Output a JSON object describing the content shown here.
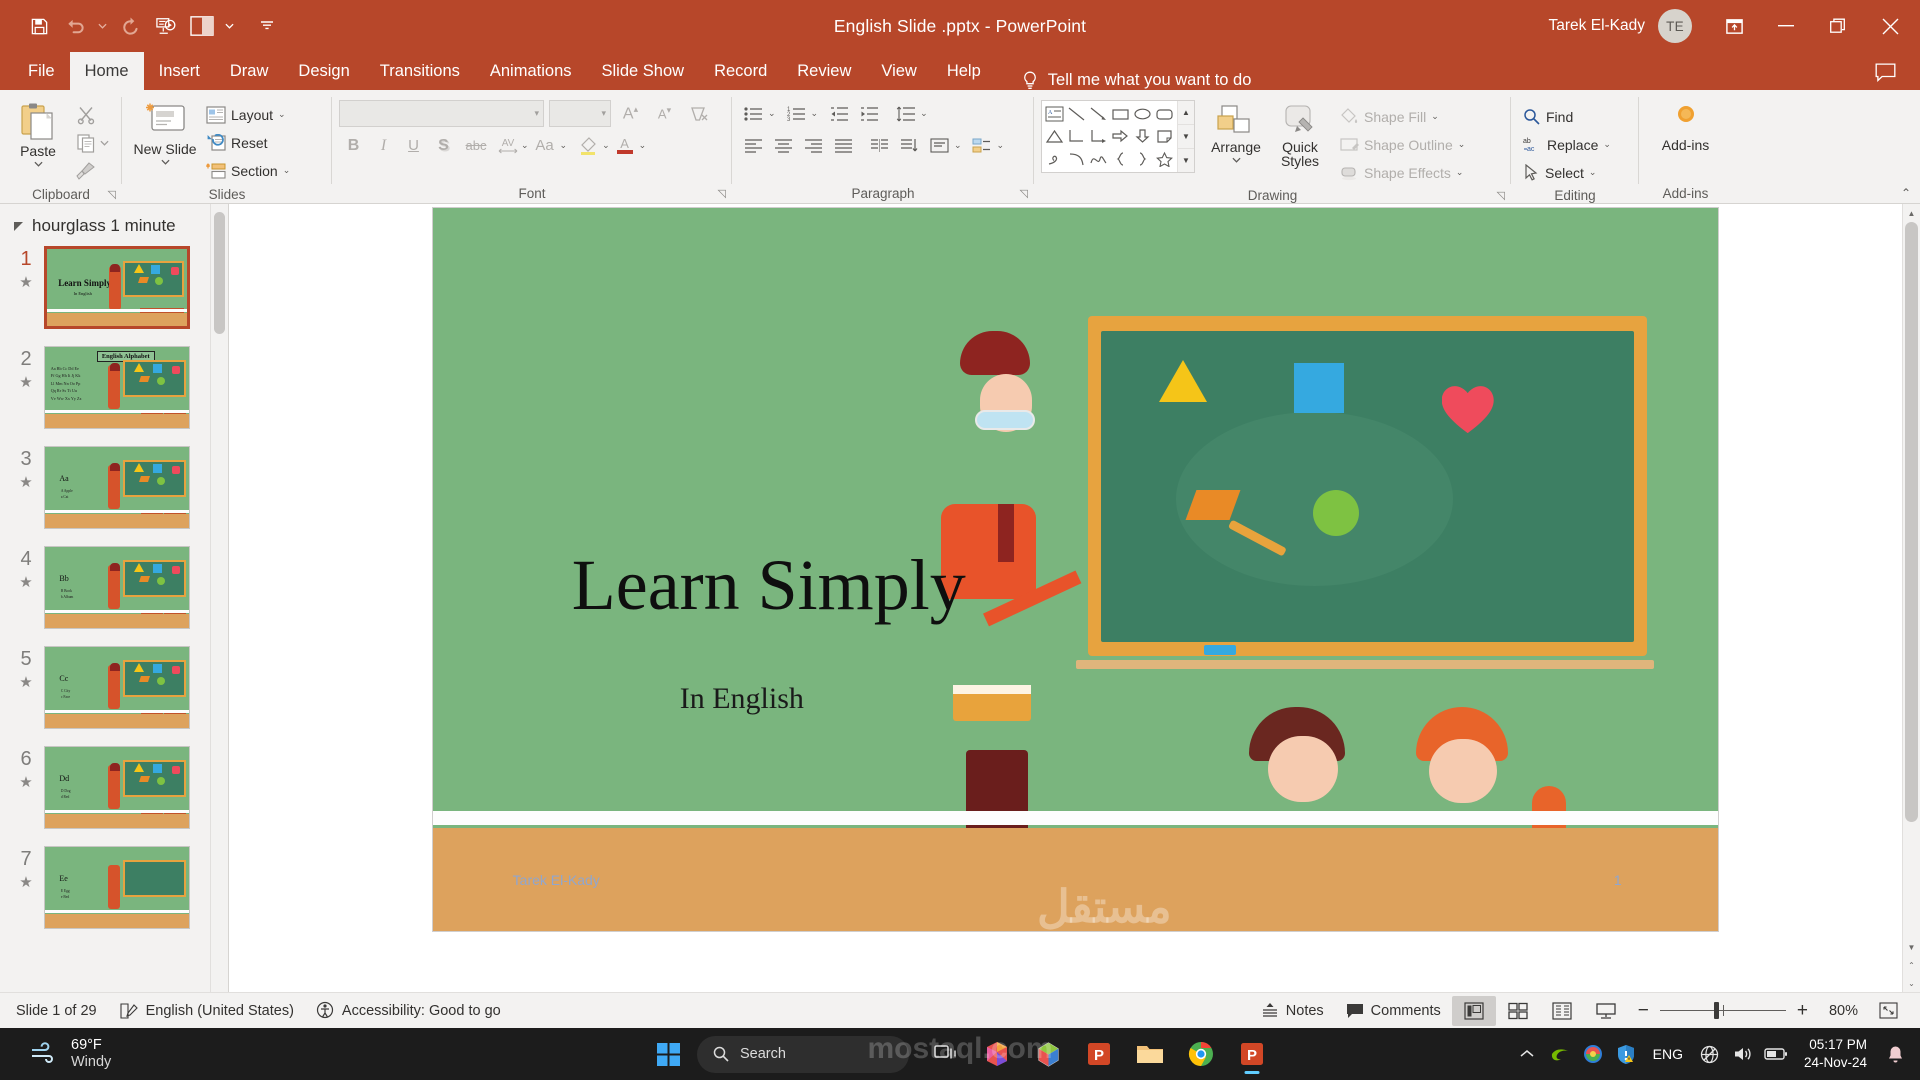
{
  "titlebar": {
    "document_title": "English Slide .pptx  -  PowerPoint",
    "user_name": "Tarek El-Kady",
    "avatar_initials": "TE",
    "qat": [
      {
        "name": "save",
        "label": "Save"
      },
      {
        "name": "undo",
        "label": "Undo"
      },
      {
        "name": "redo",
        "label": "Redo"
      },
      {
        "name": "start-presentation",
        "label": "Start From Beginning"
      },
      {
        "name": "display-mode",
        "label": "Display Settings"
      },
      {
        "name": "customize-qat",
        "label": "Customize Quick Access Toolbar"
      }
    ],
    "window_controls": [
      {
        "name": "ribbon-display-options",
        "label": "Ribbon Display Options"
      },
      {
        "name": "minimize",
        "label": "Minimize"
      },
      {
        "name": "restore",
        "label": "Restore Down"
      },
      {
        "name": "close",
        "label": "Close"
      }
    ]
  },
  "tabs": {
    "items": [
      {
        "label": "File",
        "active": false
      },
      {
        "label": "Home",
        "active": true
      },
      {
        "label": "Insert",
        "active": false
      },
      {
        "label": "Draw",
        "active": false
      },
      {
        "label": "Design",
        "active": false
      },
      {
        "label": "Transitions",
        "active": false
      },
      {
        "label": "Animations",
        "active": false
      },
      {
        "label": "Slide Show",
        "active": false
      },
      {
        "label": "Record",
        "active": false
      },
      {
        "label": "Review",
        "active": false
      },
      {
        "label": "View",
        "active": false
      },
      {
        "label": "Help",
        "active": false
      }
    ],
    "tell_me": "Tell me what you want to do",
    "comments_label": "Comments"
  },
  "ribbon": {
    "clipboard": {
      "group_label": "Clipboard",
      "paste": "Paste",
      "cut": "Cut",
      "copy": "Copy",
      "format_painter": "Format Painter"
    },
    "slides": {
      "group_label": "Slides",
      "new_slide": "New Slide",
      "layout": "Layout",
      "reset": "Reset",
      "section": "Section"
    },
    "font": {
      "group_label": "Font",
      "font_name": "",
      "font_size": "",
      "bold": "B",
      "italic": "I",
      "underline": "U",
      "shadow": "S",
      "strikethrough": "abc",
      "character_spacing": "AV",
      "change_case": "Aa",
      "increase_font": "A",
      "decrease_font": "A",
      "clear_formatting": "Clear All Formatting",
      "text_highlight": "Text Highlight Color",
      "font_color": "A"
    },
    "paragraph": {
      "group_label": "Paragraph",
      "bullets": "Bullets",
      "numbering": "Numbering",
      "decrease_indent": "Decrease List Level",
      "increase_indent": "Increase List Level",
      "line_spacing": "Line Spacing",
      "align_left": "Align Left",
      "align_center": "Center",
      "align_right": "Align Right",
      "justify": "Justify",
      "columns": "Add or Remove Columns",
      "text_direction": "Text Direction",
      "align_text": "Align Text",
      "smartart": "Convert to SmartArt"
    },
    "drawing": {
      "group_label": "Drawing",
      "arrange": "Arrange",
      "quick_styles": "Quick Styles",
      "shape_fill": "Shape Fill",
      "shape_outline": "Shape Outline",
      "shape_effects": "Shape Effects",
      "shapes": [
        "text-box",
        "line",
        "arrow",
        "rectangle",
        "oval",
        "rounded-rectangle",
        "triangle",
        "elbow-connector",
        "elbow-arrow-connector",
        "right-arrow",
        "down-arrow",
        "folded-corner",
        "scribble",
        "curve",
        "freeform-wave",
        "left-brace",
        "right-brace",
        "star"
      ]
    },
    "editing": {
      "group_label": "Editing",
      "find": "Find",
      "replace": "Replace",
      "select": "Select"
    },
    "addins": {
      "group_label": "Add-ins",
      "label": "Add-ins"
    },
    "collapse": "Collapse the Ribbon"
  },
  "thumbnails": {
    "section_name": "hourglass 1 minute",
    "slides": [
      {
        "number": "1",
        "selected": true,
        "title": "Learn Simply",
        "subtitle": "In English",
        "kind": "title"
      },
      {
        "number": "2",
        "selected": false,
        "title": "English Alphabet",
        "kind": "alphabet",
        "lines": [
          "Aa  Bb  Cc  Dd  Ee",
          "Ff  Gg  Hh  Ii  Jj  Kk",
          "Ll  Mm  Nn  Oo  Pp",
          "Qq  Rr  Ss  Tt  Uu",
          "Vv  Ww  Xx  Yy  Zz"
        ]
      },
      {
        "number": "3",
        "selected": false,
        "title": "Aa",
        "kind": "letter",
        "words": [
          "A    Apple",
          "a    Cat"
        ]
      },
      {
        "number": "4",
        "selected": false,
        "title": "Bb",
        "kind": "letter",
        "words": [
          "B    Book",
          "b    Album"
        ]
      },
      {
        "number": "5",
        "selected": false,
        "title": "Cc",
        "kind": "letter",
        "words": [
          "C    City",
          "c    Face"
        ]
      },
      {
        "number": "6",
        "selected": false,
        "title": "Dd",
        "kind": "letter",
        "words": [
          "D    Dog",
          "d    Red"
        ]
      },
      {
        "number": "7",
        "selected": false,
        "title": "Ee",
        "kind": "letter",
        "words": [
          "E    Egg",
          "e    Bed"
        ]
      }
    ]
  },
  "slide": {
    "title": "Learn Simply",
    "subtitle": "In English",
    "footer_name": "Tarek El-Kady",
    "slide_number": "1",
    "background_color": "#7ab57e",
    "floor_color": "#dda25d",
    "board_color": "#3d7f63",
    "board_frame_color": "#e7a33f"
  },
  "status_bar": {
    "slide_count": "Slide 1 of 29",
    "language": "English (United States)",
    "accessibility": "Accessibility: Good to go",
    "notes": "Notes",
    "comments": "Comments",
    "views": [
      {
        "name": "normal-view",
        "label": "Normal",
        "active": true
      },
      {
        "name": "slide-sorter-view",
        "label": "Slide Sorter",
        "active": false
      },
      {
        "name": "reading-view",
        "label": "Reading View",
        "active": false
      },
      {
        "name": "slide-show-view",
        "label": "Slide Show",
        "active": false
      }
    ],
    "zoom_out": "−",
    "zoom_in": "+",
    "zoom_level": "80%",
    "fit_slide": "Fit slide to current window"
  },
  "taskbar": {
    "weather_temp": "69°F",
    "weather_desc": "Windy",
    "search_placeholder": "Search",
    "apps": [
      {
        "name": "start",
        "label": "Start"
      },
      {
        "name": "search",
        "label": "Search"
      },
      {
        "name": "task-view",
        "label": "Task View"
      },
      {
        "name": "edge-legacy",
        "label": "Microsoft Edge"
      },
      {
        "name": "office",
        "label": "Microsoft 365"
      },
      {
        "name": "powerpoint-taskbar",
        "label": "PowerPoint"
      },
      {
        "name": "file-explorer",
        "label": "File Explorer"
      },
      {
        "name": "chrome",
        "label": "Google Chrome"
      },
      {
        "name": "powerpoint-active",
        "label": "PowerPoint"
      }
    ],
    "tray": [
      {
        "name": "show-hidden-icons",
        "label": "Show hidden icons"
      },
      {
        "name": "nvidia-icon",
        "label": "NVIDIA Settings"
      },
      {
        "name": "idm-icon",
        "label": "Internet Download Manager"
      },
      {
        "name": "defender-icon",
        "label": "Windows Security"
      }
    ],
    "language": "ENG",
    "network": "No internet access",
    "volume": "Speakers",
    "battery": "Battery",
    "time": "05:17 PM",
    "date": "24-Nov-24",
    "notifications": "Notifications"
  },
  "watermark": {
    "arabic": "مستقل",
    "latin": "mostaql.com"
  }
}
